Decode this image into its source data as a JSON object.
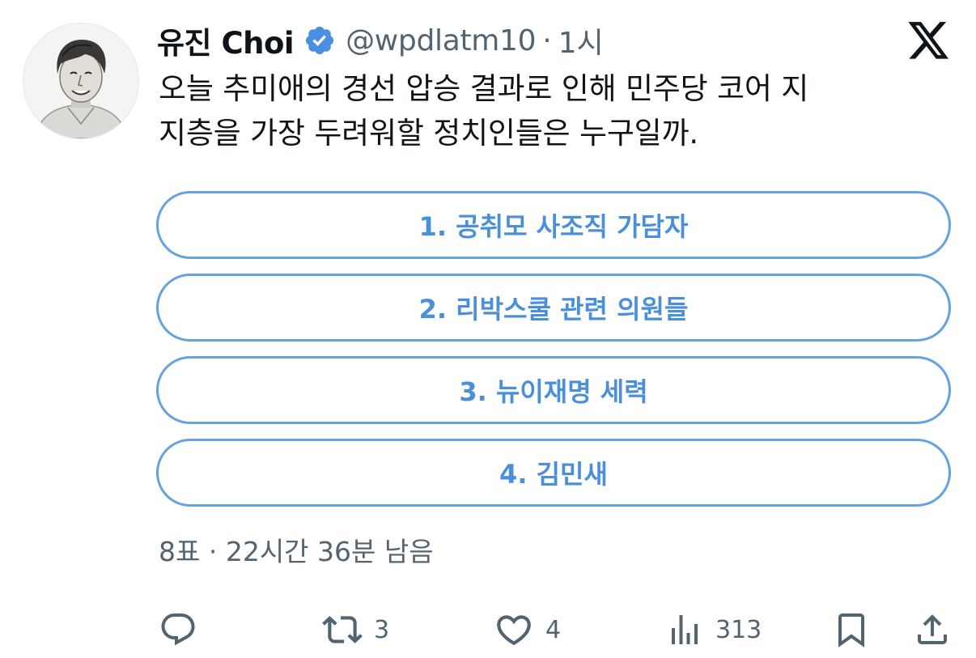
{
  "tweet": {
    "author": {
      "display_name": "유진 Choi",
      "handle": "@wpdlatm10",
      "verified": true,
      "avatar_icon": "profile-photo"
    },
    "separator": "·",
    "timestamp": "1시",
    "text_line1": "오늘 추미애의 경선 압승 결과로 인해 민주당 코어 지",
    "text_line2": "지층을 가장 두려워할 정치인들은 누구일까."
  },
  "platform_icon": "x-logo-icon",
  "poll": {
    "options": [
      {
        "label": "1. 공취모 사조직 가담자"
      },
      {
        "label": "2. 리박스쿨 관련 의원들"
      },
      {
        "label": "3. 뉴이재명 세력"
      },
      {
        "label": "4. 김민새"
      }
    ],
    "status": "8표 · 22시간 36분 남음"
  },
  "actions": {
    "reply": {
      "icon": "reply-icon",
      "count": ""
    },
    "repost": {
      "icon": "repost-icon",
      "count": "3"
    },
    "like": {
      "icon": "heart-icon",
      "count": "4"
    },
    "views": {
      "icon": "views-icon",
      "count": "313"
    },
    "bookmark": {
      "icon": "bookmark-icon"
    },
    "share": {
      "icon": "share-icon"
    }
  },
  "colors": {
    "accent": "#4a8fd9",
    "poll_border": "#64a2e0",
    "verified_badge": "#4a90e2",
    "secondary_text": "#536471",
    "primary_text": "#0f1419"
  }
}
